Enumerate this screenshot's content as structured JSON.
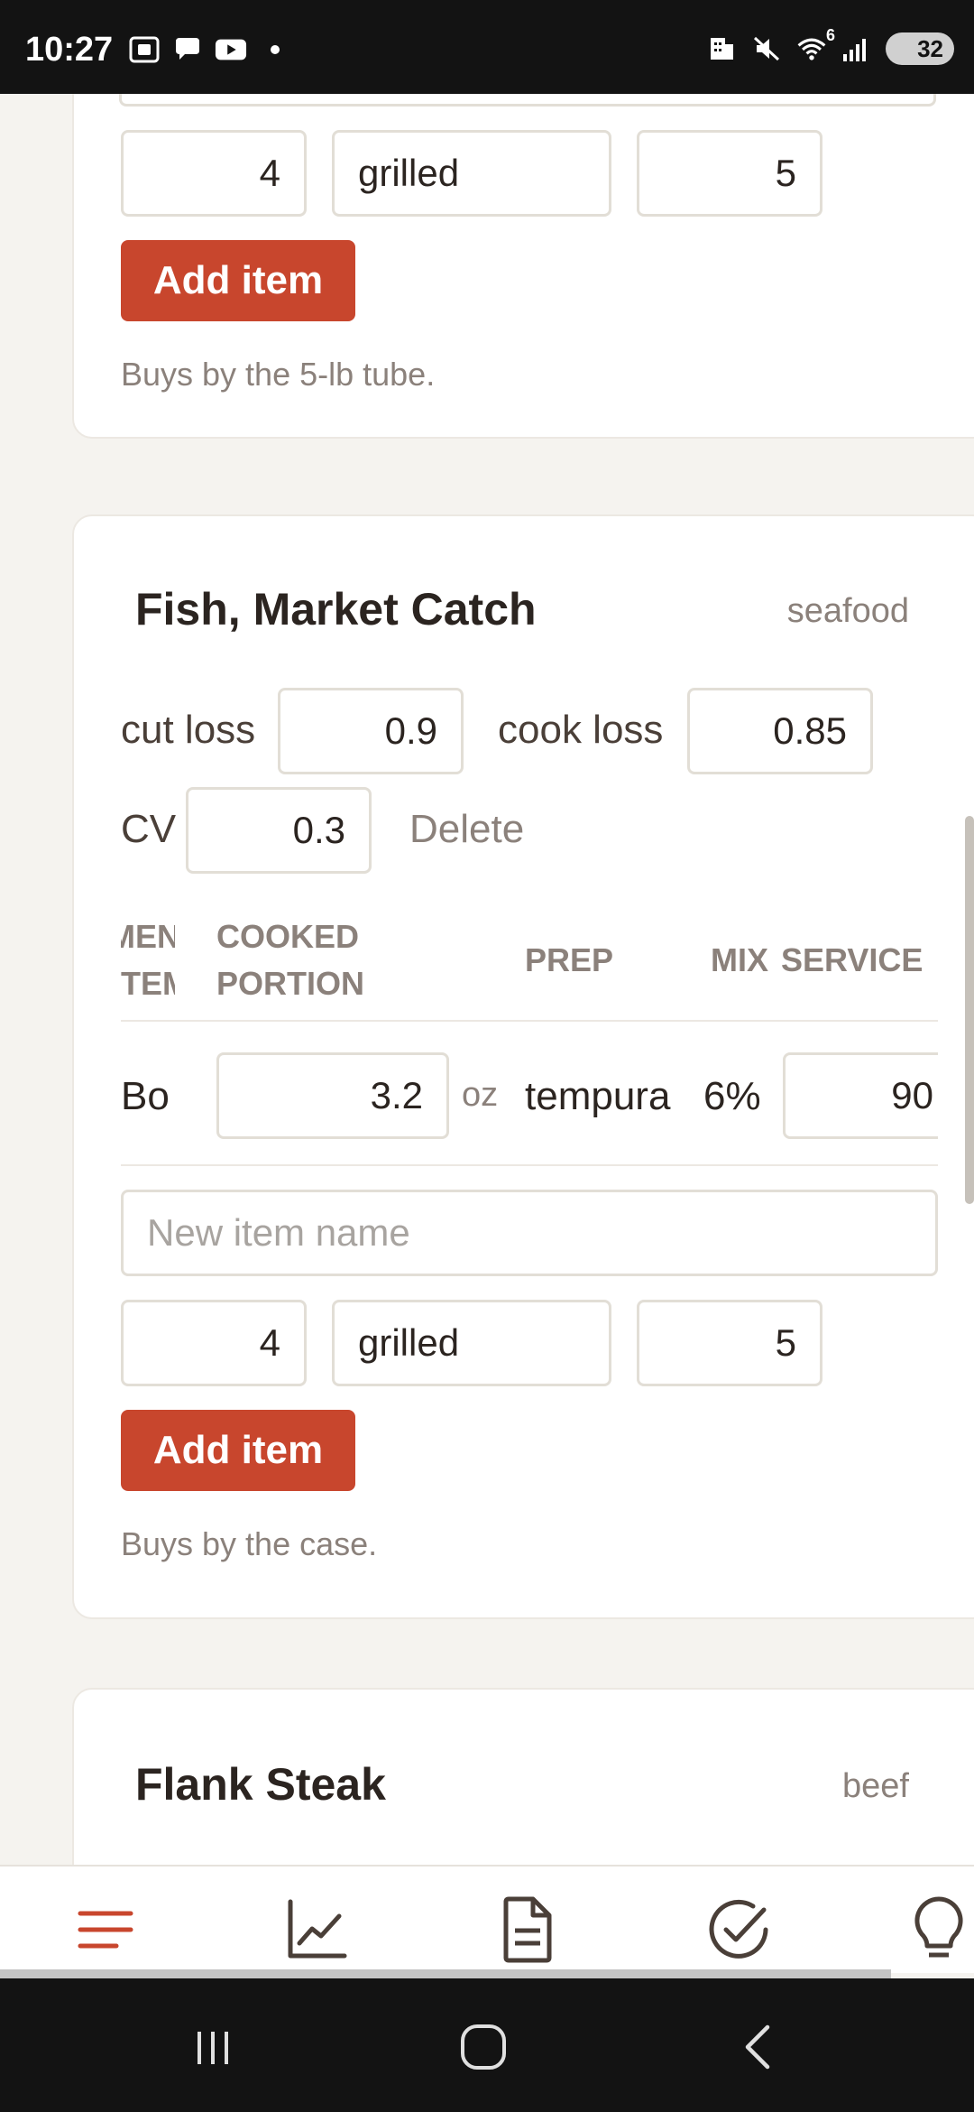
{
  "status_bar": {
    "time": "10:27",
    "network": "6",
    "battery": "32",
    "icons": [
      "screenshot-icon",
      "chat-bubble-icon",
      "youtube-icon",
      "notification-dot-icon",
      "building-icon",
      "mute-icon",
      "wifi-icon",
      "signal-icon",
      "battery-icon"
    ]
  },
  "cards": [
    {
      "inputs": {
        "portion": "4",
        "prep": "grilled",
        "service": "5"
      },
      "add_button": "Add item",
      "note": "Buys by the 5-lb tube."
    },
    {
      "title": "Fish, Market Catch",
      "category": "seafood",
      "cut_loss_label": "cut loss",
      "cut_loss_value": "0.9",
      "cook_loss_label": "cook loss",
      "cook_loss_value": "0.85",
      "cv_label": "CV",
      "cv_value": "0.3",
      "delete_label": "Delete",
      "table": {
        "headers": {
          "menu_item_l1": "MENU",
          "menu_item_l2": "ITEM",
          "cooked_l1": "COOKED",
          "cooked_l2": "PORTION",
          "prep": "PREP",
          "mix": "MIX",
          "service": "SERVICE"
        },
        "row": {
          "item": "Bo",
          "portion": "3.2",
          "unit": "oz",
          "prep": "tempura",
          "mix": "6%",
          "service": "90"
        }
      },
      "new_item_placeholder": "New item name",
      "inputs": {
        "portion": "4",
        "prep": "grilled",
        "service": "5"
      },
      "add_button": "Add item",
      "note": "Buys by the case."
    },
    {
      "title": "Flank Steak",
      "category": "beef"
    }
  ],
  "bottom_nav": {
    "items": [
      "menu-icon",
      "chart-icon",
      "document-icon",
      "check-circle-icon",
      "lightbulb-icon"
    ],
    "active_color": "#c8462d",
    "inactive_color": "#4a3f38"
  },
  "system_nav": [
    "recents-button",
    "home-button",
    "back-button"
  ],
  "colors": {
    "accent": "#c8462d",
    "background": "#f5f3ef",
    "card": "#ffffff"
  }
}
